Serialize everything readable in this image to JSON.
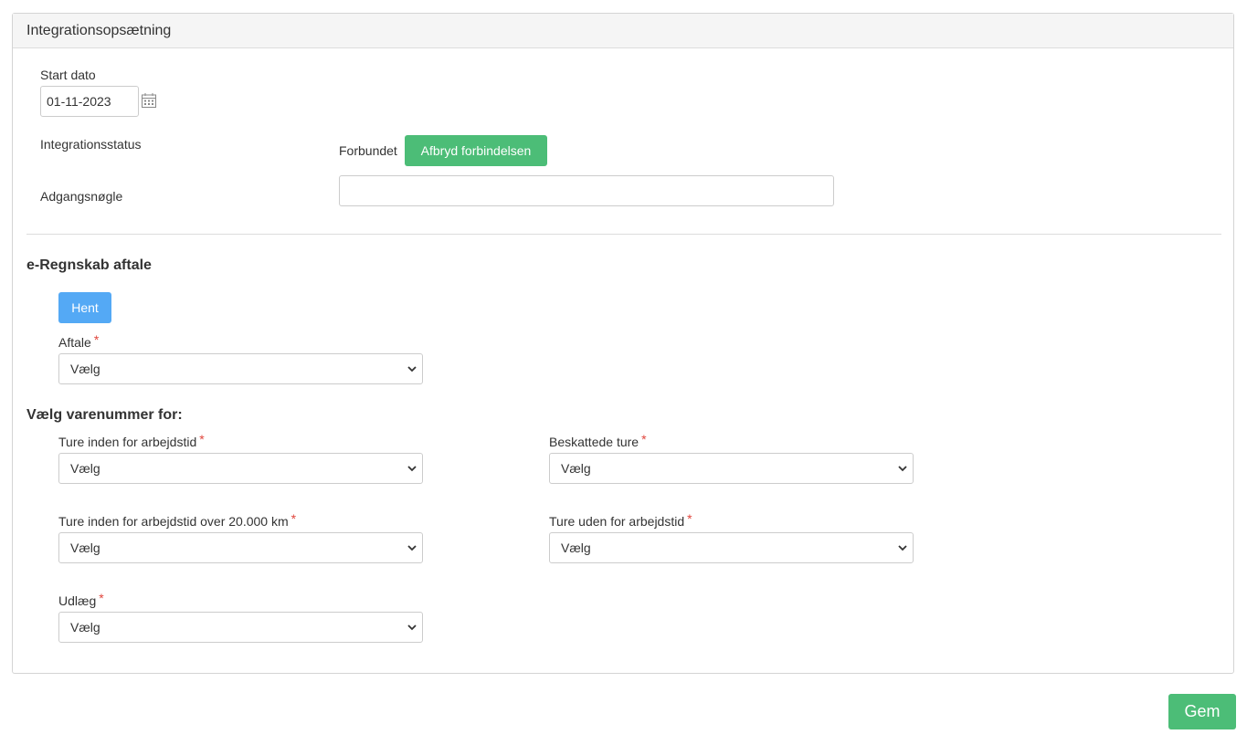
{
  "panel": {
    "title": "Integrationsopsætning"
  },
  "start_date": {
    "label": "Start dato",
    "value": "01-11-2023",
    "icon": "calendar-icon"
  },
  "status": {
    "label": "Integrationsstatus",
    "value": "Forbundet",
    "disconnect_label": "Afbryd forbindelsen"
  },
  "access_key": {
    "label": "Adgangsnøgle",
    "value": ""
  },
  "agreement": {
    "section_title": "e-Regnskab aftale",
    "fetch_label": "Hent",
    "label": "Aftale",
    "required_mark": "*",
    "selected": "Vælg"
  },
  "item_numbers": {
    "section_title": "Vælg varenummer for:",
    "fields": [
      {
        "label": "Ture inden for arbejdstid",
        "required_mark": "*",
        "selected": "Vælg"
      },
      {
        "label": "Beskattede ture",
        "required_mark": "*",
        "selected": "Vælg"
      },
      {
        "label": "Ture inden for arbejdstid over 20.000 km",
        "required_mark": "*",
        "selected": "Vælg"
      },
      {
        "label": "Ture uden for arbejdstid",
        "required_mark": "*",
        "selected": "Vælg"
      },
      {
        "label": "Udlæg",
        "required_mark": "*",
        "selected": "Vælg"
      }
    ]
  },
  "footer": {
    "save_label": "Gem"
  },
  "colors": {
    "green": "#4cbd77",
    "blue": "#54a9f5",
    "required": "#e0453c"
  }
}
